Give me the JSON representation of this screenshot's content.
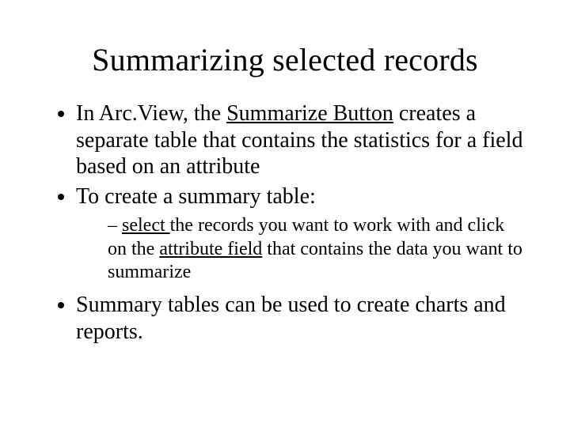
{
  "title": "Summarizing selected records",
  "b1": {
    "t1": "In Arc.View, the ",
    "u1": "Summarize Button",
    "t2": " creates a separate table that contains the statistics for a field based on an attribute"
  },
  "b2": "To create a summary table:",
  "sub1": {
    "u1": "select ",
    "t1": "the records you want to work with and click on the ",
    "u2": "attribute field",
    "t2": " that contains the data you want to summarize"
  },
  "b3": "Summary tables can be used to create charts and reports."
}
